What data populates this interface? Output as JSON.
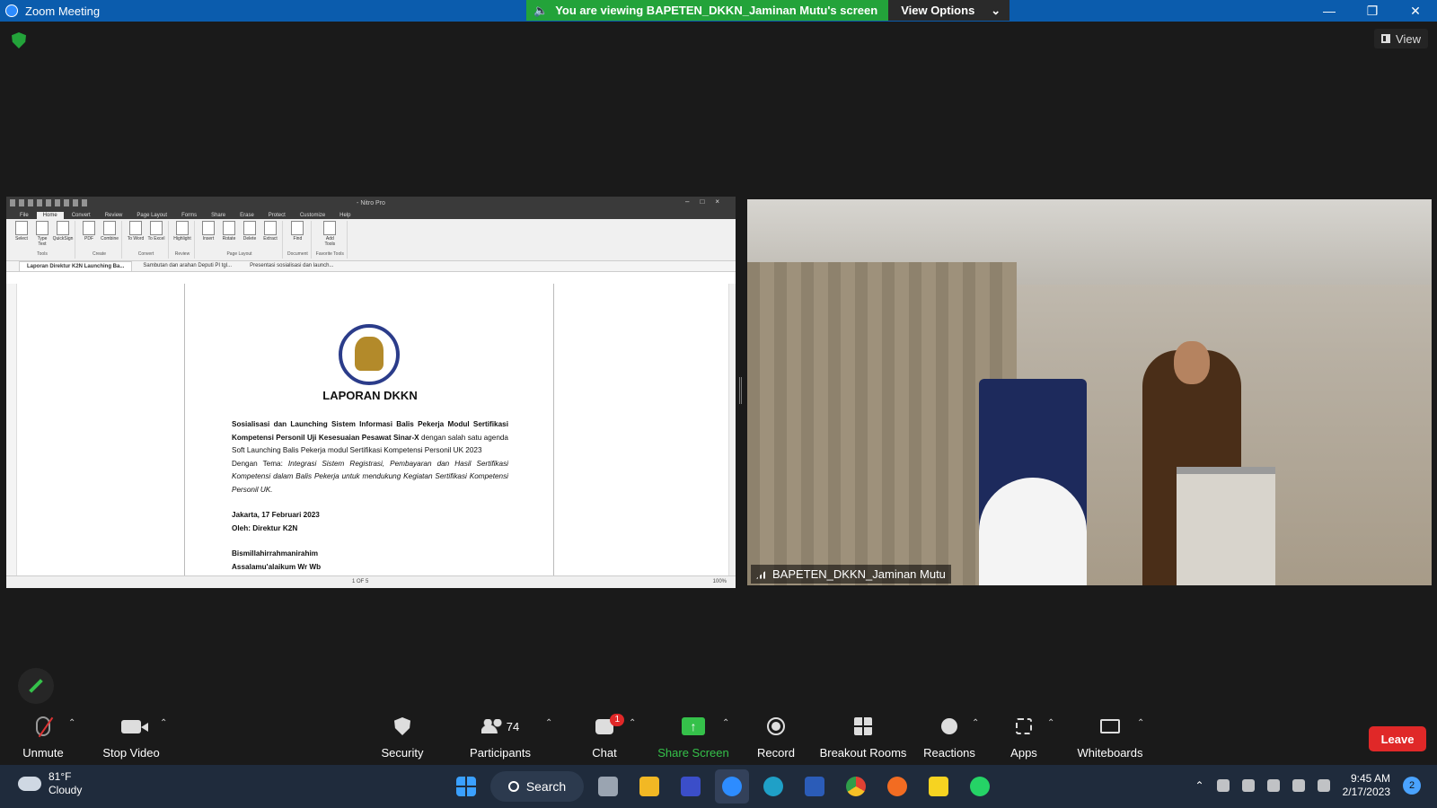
{
  "window": {
    "title": "Zoom Meeting",
    "share_banner": "You are viewing BAPETEN_DKKN_Jaminan Mutu's screen",
    "view_options": "View Options",
    "view_button": "View"
  },
  "shared_screen": {
    "app_title": "- Nitro Pro",
    "ribbon_tabs": [
      "File",
      "Home",
      "Convert",
      "Review",
      "Page Layout",
      "Forms",
      "Share",
      "Erase",
      "Protect",
      "Customize",
      "Help"
    ],
    "ribbon_groups": [
      {
        "name": "Tools",
        "tools": [
          "Select",
          "Type Text",
          "QuickSign"
        ]
      },
      {
        "name": "Create",
        "tools": [
          "PDF",
          "Combine"
        ]
      },
      {
        "name": "Convert",
        "tools": [
          "To Word",
          "To Excel"
        ]
      },
      {
        "name": "Review",
        "tools": [
          "Highlight"
        ]
      },
      {
        "name": "Page Layout",
        "tools": [
          "Insert",
          "Rotate",
          "Delete",
          "Extract"
        ]
      },
      {
        "name": "Document",
        "tools": [
          "Find"
        ]
      },
      {
        "name": "Favorite Tools",
        "tools": [
          "Add Tools"
        ]
      }
    ],
    "doc_tabs": [
      "Laporan Direktur K2N Launching Ba...",
      "Sambutan dan arahan Deputi PI tgl...",
      "Presentasi sosialisasi dan launch..."
    ],
    "doc": {
      "heading": "LAPORAN DKKN",
      "p1_bold": "Sosialisasi dan Launching Sistem Informasi Balis Pekerja Modul Sertifikasi Kompetensi Personil Uji Kesesuaian Pesawat Sinar-X",
      "p1_rest": " dengan salah satu agenda Soft Launching Balis Pekerja modul Sertifikasi Kompetensi Personil UK 2023",
      "p2_lead": "Dengan Tema: ",
      "p2_italic": "Integrasi Sistem Registrasi, Pembayaran dan Hasil Sertifikasi Kompetensi dalam Balis Pekerja untuk mendukung Kegiatan Sertifikasi Kompetensi Personil UK.",
      "date_line": "Jakarta, 17 Februari 2023",
      "by_line": "Oleh: Direktur K2N",
      "greeting1": "Bismillahirrahmanirahim",
      "greeting2": "Assalamu'alaikum Wr Wb"
    },
    "page_indicator": "1 OF 5",
    "zoom_level": "100%"
  },
  "video": {
    "participant_name": "BAPETEN_DKKN_Jaminan Mutu"
  },
  "toolbar": {
    "unmute": "Unmute",
    "stop_video": "Stop Video",
    "security": "Security",
    "participants": "Participants",
    "participants_count": "74",
    "chat": "Chat",
    "chat_badge": "1",
    "share_screen": "Share Screen",
    "record": "Record",
    "breakout_rooms": "Breakout Rooms",
    "reactions": "Reactions",
    "apps": "Apps",
    "whiteboards": "Whiteboards",
    "leave": "Leave"
  },
  "taskbar": {
    "temperature": "81°F",
    "weather": "Cloudy",
    "search": "Search",
    "time": "9:45 AM",
    "date": "2/17/2023",
    "notifications": "2"
  },
  "colors": {
    "zoom_blue": "#0b5cad",
    "banner_green": "#23a33a",
    "leave_red": "#e02828"
  }
}
